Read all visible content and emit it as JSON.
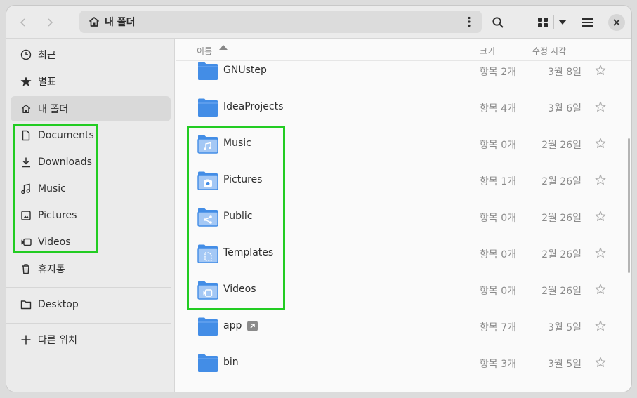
{
  "header": {
    "back_icon": "chevron-left-icon",
    "forward_icon": "chevron-right-icon",
    "path_label": "내 폴더",
    "path_icon": "home-icon",
    "path_menu_icon": "kebab-icon",
    "search_icon": "search-icon",
    "view_icon": "grid-view-icon",
    "view_dropdown_icon": "caret-down-icon",
    "menu_icon": "hamburger-icon",
    "close_icon": "close-icon"
  },
  "sidebar": {
    "items": [
      {
        "label": "최근",
        "icon": "clock-icon"
      },
      {
        "label": "별표",
        "icon": "star-icon"
      },
      {
        "label": "내 폴더",
        "icon": "home-icon",
        "active": true
      },
      {
        "label": "Documents",
        "icon": "document-icon"
      },
      {
        "label": "Downloads",
        "icon": "download-icon"
      },
      {
        "label": "Music",
        "icon": "music-icon"
      },
      {
        "label": "Pictures",
        "icon": "picture-icon"
      },
      {
        "label": "Videos",
        "icon": "video-icon"
      },
      {
        "label": "휴지통",
        "icon": "trash-icon"
      },
      {
        "label": "Desktop",
        "icon": "folder-icon"
      },
      {
        "label": "다른 위치",
        "icon": "plus-icon"
      }
    ]
  },
  "columns": {
    "name": "이름",
    "size": "크기",
    "modified": "수정 시각"
  },
  "files": [
    {
      "name": "GNUstep",
      "size": "항목 2개",
      "date": "3월 8일",
      "emblem": "none"
    },
    {
      "name": "IdeaProjects",
      "size": "항목 4개",
      "date": "3월 6일",
      "emblem": "none"
    },
    {
      "name": "Music",
      "size": "항목 0개",
      "date": "2월 26일",
      "emblem": "music"
    },
    {
      "name": "Pictures",
      "size": "항목 1개",
      "date": "2월 26일",
      "emblem": "camera"
    },
    {
      "name": "Public",
      "size": "항목 0개",
      "date": "2월 26일",
      "emblem": "share"
    },
    {
      "name": "Templates",
      "size": "항목 0개",
      "date": "2월 26일",
      "emblem": "template"
    },
    {
      "name": "Videos",
      "size": "항목 0개",
      "date": "2월 26일",
      "emblem": "video"
    },
    {
      "name": "app",
      "size": "항목 7개",
      "date": "3월 5일",
      "emblem": "none",
      "symlink": true
    },
    {
      "name": "bin",
      "size": "항목 3개",
      "date": "3월 5일",
      "emblem": "none"
    }
  ],
  "colors": {
    "folder_blue": "#438de6",
    "folder_light": "#a4c8f5",
    "highlight": "#22cc22"
  }
}
